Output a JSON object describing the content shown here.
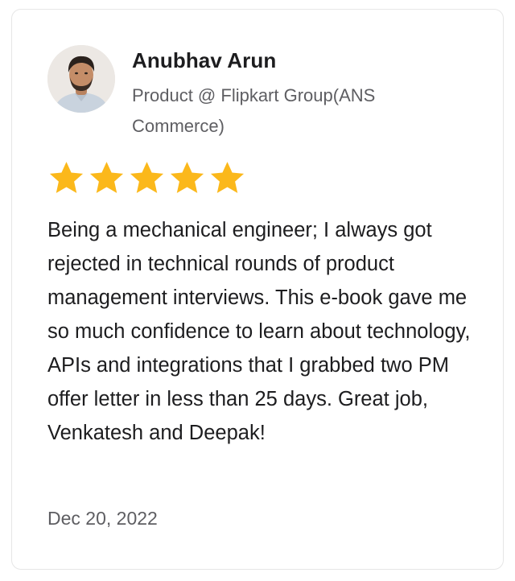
{
  "reviewer": {
    "name": "Anubhav Arun",
    "title": "Product @ Flipkart Group(ANS Commerce)"
  },
  "rating": {
    "value": 5,
    "max": 5,
    "star_color": "#fbb81b"
  },
  "review": {
    "text": "Being a mechanical engineer; I always got rejected in technical rounds of product management interviews. This e-book gave me so much confidence to learn about technology, APIs and integrations that I grabbed two PM offer letter in less than 25 days. Great job, Venkatesh and Deepak!",
    "date": "Dec 20, 2022"
  }
}
